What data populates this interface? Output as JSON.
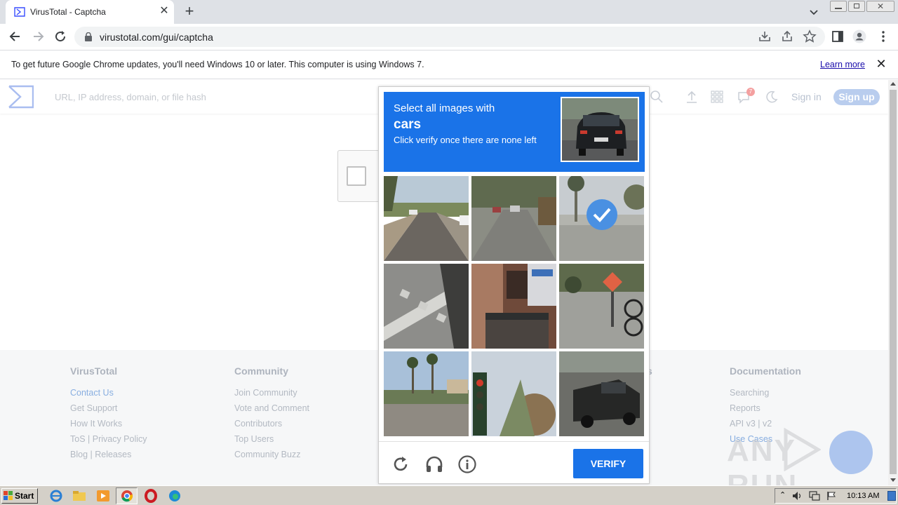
{
  "browser": {
    "tab_title": "VirusTotal - Captcha",
    "url": "virustotal.com/gui/captcha",
    "new_tab_symbol": "+",
    "close_symbol": "✕"
  },
  "infobar": {
    "message": "To get future Google Chrome updates, you'll need Windows 10 or later. This computer is using Windows 7.",
    "learn_more": "Learn more"
  },
  "vt_header": {
    "search_placeholder": "URL, IP address, domain, or file hash",
    "notification_count": "7",
    "sign_in": "Sign in",
    "sign_up": "Sign up"
  },
  "footer": {
    "columns": [
      {
        "title": "VirusTotal",
        "links": [
          "Contact Us",
          "Get Support",
          "How It Works",
          "ToS | Privacy Policy",
          "Blog | Releases"
        ]
      },
      {
        "title": "Community",
        "links": [
          "Join Community",
          "Vote and Comment",
          "Contributors",
          "Top Users",
          "Community Buzz"
        ]
      },
      {
        "title": "Documentation",
        "links": [
          "Searching",
          "Reports",
          "API v3 | v2",
          "Use Cases"
        ]
      }
    ],
    "partial_title_fragment": "s"
  },
  "challenge": {
    "instruction": "Select all images with",
    "target": "cars",
    "hint": "Click verify once there are none left",
    "verify_label": "VERIFY",
    "tiles": [
      {
        "scene": "street-with-cars",
        "selected": false
      },
      {
        "scene": "street-noisy",
        "selected": false
      },
      {
        "scene": "palm-trees-sidewalk",
        "selected": true
      },
      {
        "scene": "crosswalk",
        "selected": false
      },
      {
        "scene": "building-storefront",
        "selected": false
      },
      {
        "scene": "road-sign-bicycle",
        "selected": false
      },
      {
        "scene": "palm-trees-road",
        "selected": false
      },
      {
        "scene": "traffic-light",
        "selected": false
      },
      {
        "scene": "pickup-truck",
        "selected": false
      }
    ]
  },
  "watermark": "ANY RUN",
  "taskbar": {
    "start_label": "Start",
    "clock": "10:13 AM"
  },
  "colors": {
    "captcha_blue": "#1a73e8",
    "selected_check": "#4a90e2"
  }
}
